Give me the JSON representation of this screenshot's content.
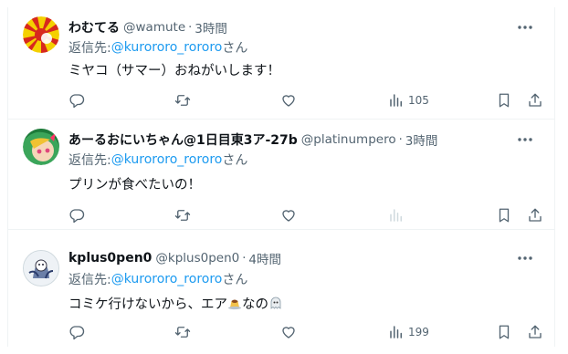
{
  "tweets": [
    {
      "name": "わむてる",
      "handle": "@wamute",
      "dot": "·",
      "time": "3時間",
      "reply_prefix": "返信先: ",
      "reply_mention": "@kurororo_rororo",
      "reply_suffix": "さん",
      "text": "ミヤコ（サマー）おねがいします！",
      "views": "105"
    },
    {
      "name": "あーるおにいちゃん@1日目東3ア-27b",
      "handle": "@platinumpero",
      "dot": "·",
      "time": "3時間",
      "reply_prefix": "返信先: ",
      "reply_mention": "@kurororo_rororo",
      "reply_suffix": "さん",
      "text": "プリンが食べたいの！",
      "views": ""
    },
    {
      "name": "kplus0pen0",
      "handle": "@kplus0pen0",
      "dot": "·",
      "time": "4時間",
      "reply_prefix": "返信先: ",
      "reply_mention": "@kurororo_rororo",
      "reply_suffix": "さん",
      "text_before": "コミケ行けないから、エア",
      "text_middle": "なの",
      "views": "199"
    }
  ],
  "icons": {
    "more": "more-icon",
    "reply": "reply-icon",
    "retweet": "retweet-icon",
    "like": "like-icon",
    "views": "views-icon",
    "bookmark": "bookmark-icon",
    "share": "share-icon",
    "pudding": "pudding-emoji",
    "ghost": "ghost-emoji"
  },
  "colors": {
    "text": "#0f1419",
    "secondary": "#536471",
    "link": "#1d9bf0",
    "border": "#eff3f4"
  }
}
